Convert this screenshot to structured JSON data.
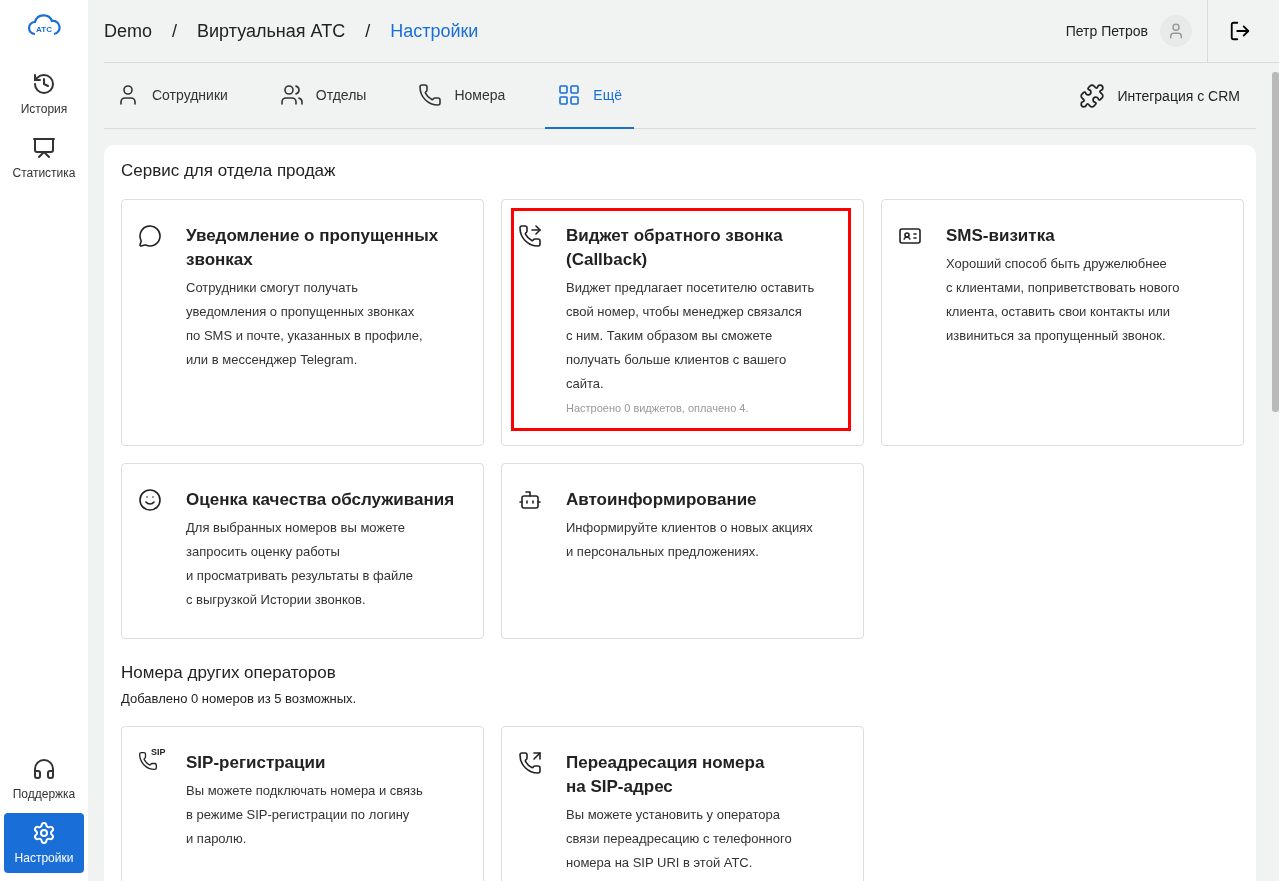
{
  "logo": {
    "text": "АТС"
  },
  "sidebar": {
    "items": [
      {
        "kind": "history",
        "label": "История",
        "selected": false
      },
      {
        "kind": "stats",
        "label": "Статистика",
        "selected": false
      }
    ],
    "bottom_items": [
      {
        "kind": "support",
        "label": "Поддержка",
        "selected": false
      },
      {
        "kind": "settings",
        "label": "Настройки",
        "selected": true
      }
    ]
  },
  "breadcrumbs": [
    {
      "label": "Demo",
      "current": false
    },
    {
      "label": "Виртуальная АТС",
      "current": false
    },
    {
      "label": "Настройки",
      "current": true
    }
  ],
  "breadcrumb_separator": "/",
  "user": {
    "name": "Петр Петров"
  },
  "tabs": [
    {
      "kind": "person",
      "label": "Сотрудники",
      "selected": false
    },
    {
      "kind": "people",
      "label": "Отделы",
      "selected": false
    },
    {
      "kind": "phone",
      "label": "Номера",
      "selected": false
    },
    {
      "kind": "grid",
      "label": "Ещё",
      "selected": true
    }
  ],
  "integration": {
    "label": "Интеграция с CRM"
  },
  "sections": [
    {
      "title": "Сервис для отдела продаж",
      "cards": [
        {
          "kind": "chat",
          "title": [
            "Уведомление о пропущенных",
            "звонках"
          ],
          "lines": [
            "Сотрудники смогут получать",
            "уведомления о пропущенных звонках",
            "по SMS и почте, указанных в профиле,",
            "или в мессенджер Telegram."
          ],
          "highlighted": false
        },
        {
          "kind": "callback",
          "title": [
            "Виджет обратного звонка",
            "(Callback)"
          ],
          "lines": [
            "Виджет предлагает посетителю оставить",
            "свой номер, чтобы менеджер связался",
            "с ним. Таким образом вы сможете",
            "получать больше клиентов с вашего",
            "сайта."
          ],
          "note": "Настроено 0 виджетов, оплачено 4.",
          "highlighted": true
        },
        {
          "kind": "card",
          "title": [
            "SMS-визитка"
          ],
          "lines": [
            "Хороший способ быть дружелюбнее",
            "с клиентами, поприветствовать нового",
            "клиента, оставить свои контакты или",
            "извиниться за пропущенный звонок."
          ],
          "highlighted": false
        },
        {
          "kind": "smiles",
          "title": [
            "Оценка качества обслуживания"
          ],
          "lines": [
            "Для выбранных номеров вы можете",
            "запросить оценку работы",
            "и просматривать результаты в файле",
            "с выгрузкой Истории звонков."
          ],
          "highlighted": false
        },
        {
          "kind": "robot",
          "title": [
            "Автоинформирование"
          ],
          "lines": [
            "Информируйте клиентов о новых акциях",
            "и персональных предложениях."
          ],
          "highlighted": false
        }
      ]
    },
    {
      "title": "Номера других операторов",
      "subtitle": "Добавлено 0 номеров из 5 возможных.",
      "cards": [
        {
          "kind": "sip",
          "icon_text": "SIP",
          "title": [
            "SIP-регистрации"
          ],
          "lines": [
            "Вы можете подключать номера и связь",
            "в режиме SIP-регистрации по логину",
            "и паролю."
          ],
          "highlighted": false
        },
        {
          "kind": "forward",
          "title": [
            "Переадресация номера",
            "на SIP-адрес"
          ],
          "lines": [
            "Вы можете установить у оператора",
            "связи переадресацию с телефонного",
            "номера на SIP URI в этой АТС."
          ],
          "highlighted": false
        }
      ]
    }
  ]
}
